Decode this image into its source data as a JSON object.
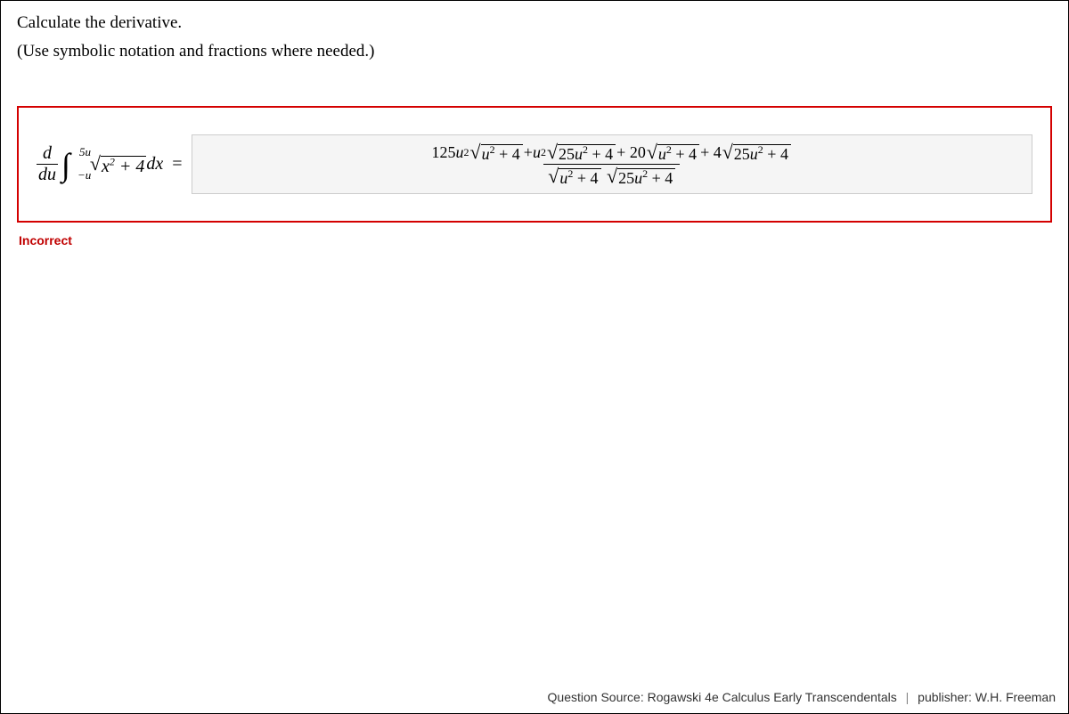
{
  "prompt": {
    "line1": "Calculate the derivative.",
    "line2": "(Use symbolic notation and fractions where needed.)"
  },
  "lhs": {
    "frac_num": "d",
    "frac_den": "du",
    "int_upper": "5u",
    "int_lower": "−u",
    "sqrt_inner": "x",
    "sqrt_inner_exp": "2",
    "plus4": " + 4",
    "dx": " dx",
    "equals": "="
  },
  "answer": {
    "num_t1_coef": "125",
    "num_t1_var": "u",
    "num_t1_exp": "2",
    "num_t1_sqrt_var": "u",
    "num_t1_sqrt_exp": "2",
    "num_t1_sqrt_tail": " + 4",
    "num_plus1": " + ",
    "num_t2_var": "u",
    "num_t2_exp": "2",
    "num_t2_sqrt_coef": "25",
    "num_t2_sqrt_var": "u",
    "num_t2_sqrt_exp": "2",
    "num_t2_sqrt_tail": " + 4",
    "num_plus2": " + 20",
    "num_t3_sqrt_var": "u",
    "num_t3_sqrt_exp": "2",
    "num_t3_sqrt_tail": " + 4",
    "num_plus3": " + 4",
    "num_t4_sqrt_coef": "25",
    "num_t4_sqrt_var": "u",
    "num_t4_sqrt_exp": "2",
    "num_t4_sqrt_tail": " + 4",
    "den_s1_var": "u",
    "den_s1_exp": "2",
    "den_s1_tail": " + 4",
    "den_s2_coef": "25",
    "den_s2_var": "u",
    "den_s2_exp": "2",
    "den_s2_tail": " + 4"
  },
  "feedback": "Incorrect",
  "footer": {
    "source_label": "Question Source:",
    "source_value": "Rogawski 4e Calculus Early Transcendentals",
    "publisher_label": "publisher:",
    "publisher_value": "W.H. Freeman"
  }
}
